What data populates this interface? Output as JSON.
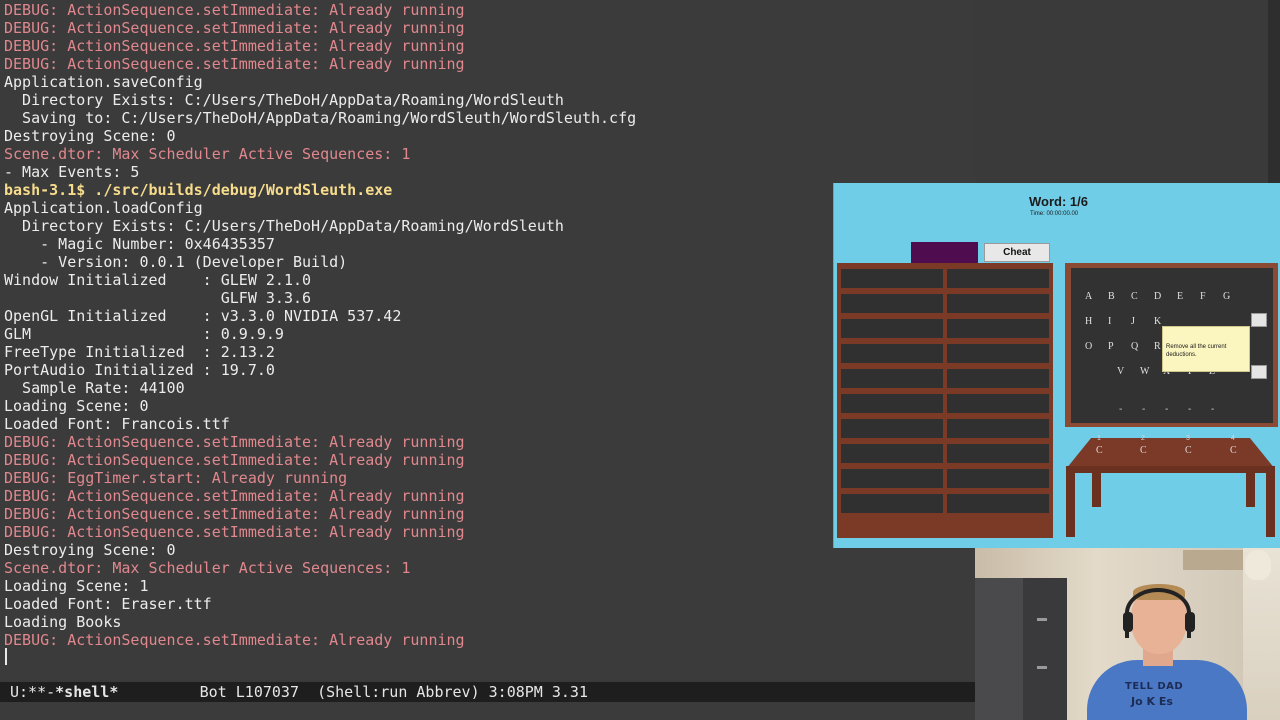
{
  "terminal": {
    "lines": [
      {
        "text": "DEBUG: ActionSequence.setImmediate: Already running",
        "kind": "debug"
      },
      {
        "text": "DEBUG: ActionSequence.setImmediate: Already running",
        "kind": "debug"
      },
      {
        "text": "DEBUG: ActionSequence.setImmediate: Already running",
        "kind": "debug"
      },
      {
        "text": "DEBUG: ActionSequence.setImmediate: Already running",
        "kind": "debug"
      },
      {
        "text": "Application.saveConfig",
        "kind": "normal"
      },
      {
        "text": "  Directory Exists: C:/Users/TheDoH/AppData/Roaming/WordSleuth",
        "kind": "normal"
      },
      {
        "text": "  Saving to: C:/Users/TheDoH/AppData/Roaming/WordSleuth/WordSleuth.cfg",
        "kind": "normal"
      },
      {
        "text": "Destroying Scene: 0",
        "kind": "normal"
      },
      {
        "text": "Scene.dtor: Max Scheduler Active Sequences: 1",
        "kind": "debug"
      },
      {
        "text": "- Max Events: 5",
        "kind": "normal"
      },
      {
        "text": "bash-3.1$ ./src/builds/debug/WordSleuth.exe",
        "kind": "prompt"
      },
      {
        "text": "Application.loadConfig",
        "kind": "normal"
      },
      {
        "text": "  Directory Exists: C:/Users/TheDoH/AppData/Roaming/WordSleuth",
        "kind": "normal"
      },
      {
        "text": "    - Magic Number: 0x46435357",
        "kind": "normal"
      },
      {
        "text": "    - Version: 0.0.1 (Developer Build)",
        "kind": "normal"
      },
      {
        "text": "Window Initialized    : GLEW 2.1.0",
        "kind": "normal"
      },
      {
        "text": "                        GLFW 3.3.6",
        "kind": "normal"
      },
      {
        "text": "OpenGL Initialized    : v3.3.0 NVIDIA 537.42",
        "kind": "normal"
      },
      {
        "text": "GLM                   : 0.9.9.9",
        "kind": "normal"
      },
      {
        "text": "FreeType Initialized  : 2.13.2",
        "kind": "normal"
      },
      {
        "text": "PortAudio Initialized : 19.7.0",
        "kind": "normal"
      },
      {
        "text": "  Sample Rate: 44100",
        "kind": "normal"
      },
      {
        "text": "Loading Scene: 0",
        "kind": "normal"
      },
      {
        "text": "Loaded Font: Francois.ttf",
        "kind": "normal"
      },
      {
        "text": "DEBUG: ActionSequence.setImmediate: Already running",
        "kind": "debug"
      },
      {
        "text": "DEBUG: ActionSequence.setImmediate: Already running",
        "kind": "debug"
      },
      {
        "text": "DEBUG: EggTimer.start: Already running",
        "kind": "debug"
      },
      {
        "text": "DEBUG: ActionSequence.setImmediate: Already running",
        "kind": "debug"
      },
      {
        "text": "DEBUG: ActionSequence.setImmediate: Already running",
        "kind": "debug"
      },
      {
        "text": "DEBUG: ActionSequence.setImmediate: Already running",
        "kind": "debug"
      },
      {
        "text": "Destroying Scene: 0",
        "kind": "normal"
      },
      {
        "text": "Scene.dtor: Max Scheduler Active Sequences: 1",
        "kind": "debug"
      },
      {
        "text": "Loading Scene: 1",
        "kind": "normal"
      },
      {
        "text": "Loaded Font: Eraser.ttf",
        "kind": "normal"
      },
      {
        "text": "Loading Books",
        "kind": "normal"
      },
      {
        "text": "DEBUG: ActionSequence.setImmediate: Already running",
        "kind": "debug"
      }
    ]
  },
  "modeline": {
    "state": "U:**-",
    "buffer": "*shell*",
    "position": "Bot L107037",
    "modes": "(Shell:run Abbrev)",
    "time": "3:08PM",
    "load": "3.31"
  },
  "game": {
    "title": "Word: 1/6",
    "time": "Time: 00:00:00.00",
    "cheat_label": "Cheat",
    "tooltip": "Remove all the current deductions.",
    "board_letters": [
      [
        "A",
        "B",
        "C",
        "D",
        "E",
        "F",
        "G"
      ],
      [
        "H",
        "I",
        "J",
        "K",
        "",
        "",
        ""
      ],
      [
        "O",
        "P",
        "Q",
        "R",
        "",
        "",
        ""
      ],
      [
        "V",
        "W",
        "X",
        "Y",
        "Z"
      ]
    ],
    "blanks": [
      "-",
      "-",
      "-",
      "-",
      "-"
    ],
    "table_numbers": [
      "1",
      "2",
      "3",
      "4"
    ],
    "table_letters": [
      "C",
      "C",
      "C",
      "C"
    ],
    "colors": {
      "sky": "#6fcde8",
      "shelf": "#7a3a26",
      "purple": "#4f0c4f"
    }
  },
  "webcam": {
    "shirt_line1": "TELL DAD",
    "shirt_line2": "Jo K Es"
  },
  "colors": {
    "terminal_bg": "#3b3b3b",
    "debug": "#e0888e",
    "prompt": "#f7dc8c",
    "text": "#ececec"
  }
}
